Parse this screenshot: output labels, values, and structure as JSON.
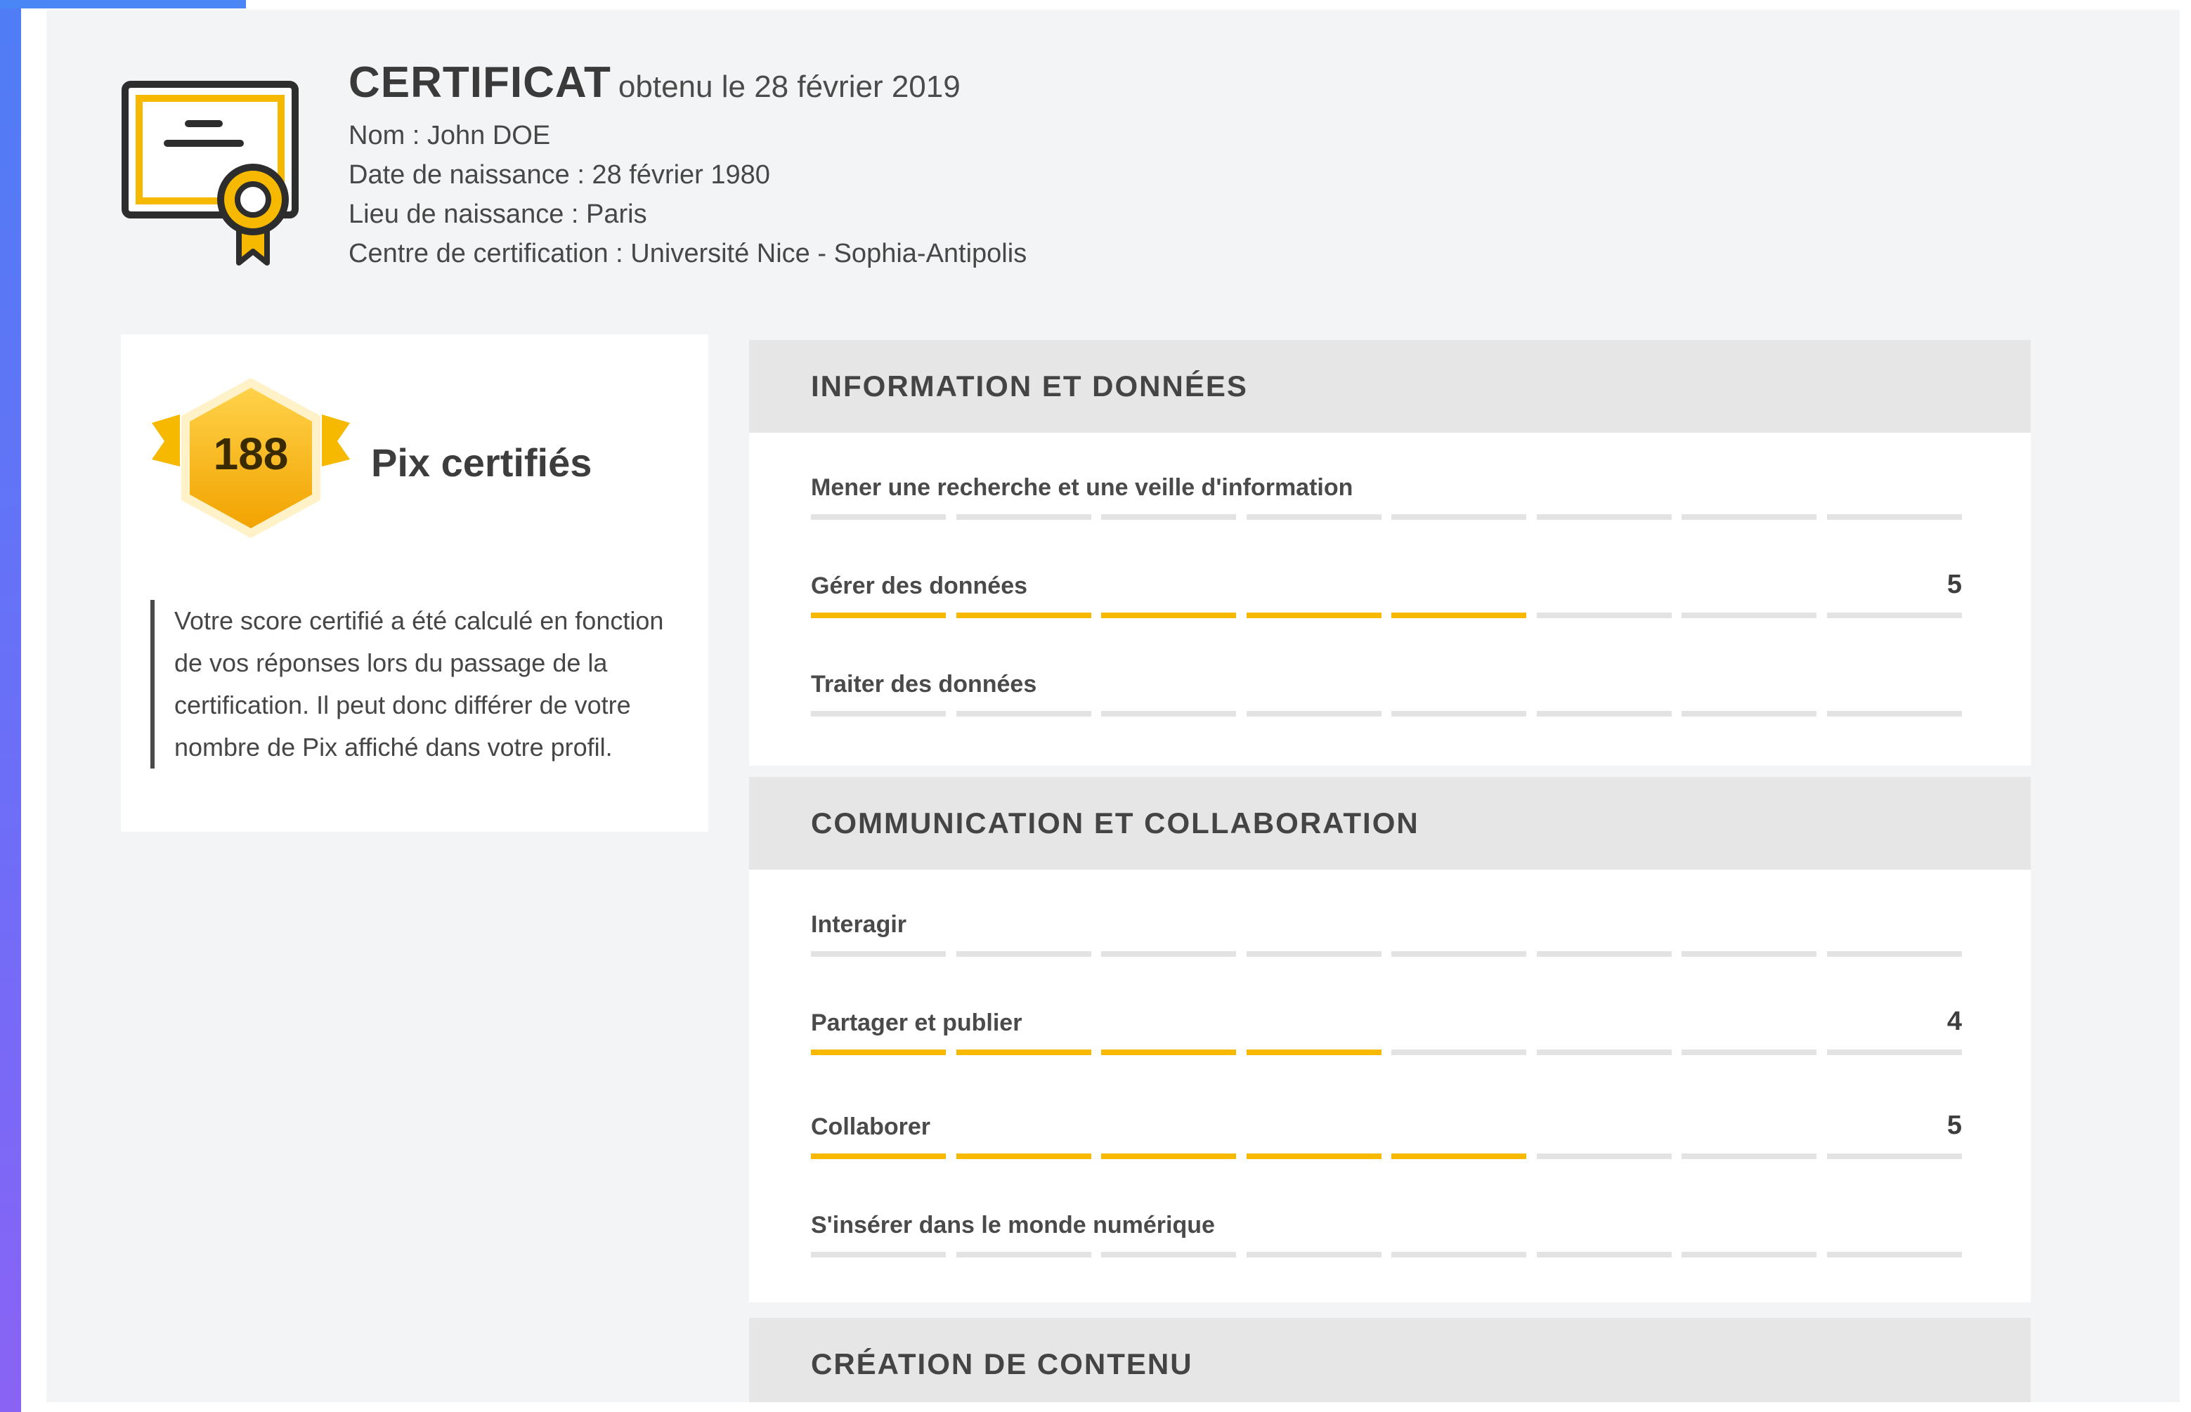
{
  "certificate": {
    "title": "CERTIFICAT",
    "obtained": "obtenu le 28 février 2019",
    "name_line": "Nom : John DOE",
    "birthdate_line": "Date de naissance : 28 février 1980",
    "birthplace_line": "Lieu de naissance : Paris",
    "center_line": "Centre de certification : Université Nice - Sophia-Antipolis"
  },
  "score": {
    "value": "188",
    "label": "Pix certifiés",
    "note": "Votre score certifié a été calculé en fonction de vos réponses lors du passage de la certification. Il peut donc différer de votre nombre de Pix affiché dans votre profil."
  },
  "colors": {
    "accent": "#f6b900",
    "bar_empty": "#e3e3e3",
    "header_bg": "#e6e6e6"
  },
  "domains": [
    {
      "title": "INFORMATION ET DONNÉES",
      "competences": [
        {
          "name": "Mener une recherche et une veille d'information",
          "level": "",
          "filled": 0
        },
        {
          "name": "Gérer des données",
          "level": "5",
          "filled": 5
        },
        {
          "name": "Traiter des données",
          "level": "",
          "filled": 0
        }
      ]
    },
    {
      "title": "COMMUNICATION ET COLLABORATION",
      "competences": [
        {
          "name": "Interagir",
          "level": "",
          "filled": 0
        },
        {
          "name": "Partager et publier",
          "level": "4",
          "filled": 4
        },
        {
          "name": "Collaborer",
          "level": "5",
          "filled": 5
        },
        {
          "name": "S'insérer dans le monde numérique",
          "level": "",
          "filled": 0
        }
      ]
    },
    {
      "title": "CRÉATION DE CONTENU",
      "competences": []
    }
  ]
}
